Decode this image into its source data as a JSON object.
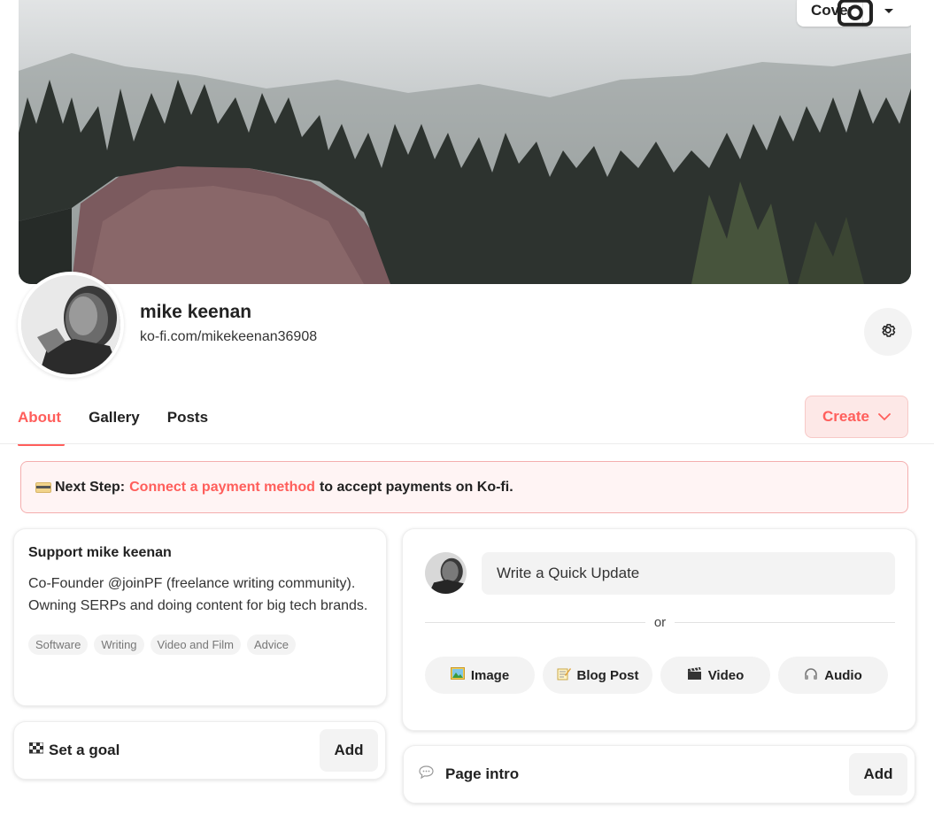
{
  "cover": {
    "button_label": "Cover",
    "camera_icon": "camera-icon",
    "dropdown_icon": "caret-down-icon"
  },
  "profile": {
    "name": "mike keenan",
    "handle": "ko-fi.com/mikekeenan36908",
    "settings_icon": "gear-icon"
  },
  "tabs": [
    {
      "label": "About",
      "active": true
    },
    {
      "label": "Gallery",
      "active": false
    },
    {
      "label": "Posts",
      "active": false
    }
  ],
  "create": {
    "label": "Create",
    "icon": "chevron-down-icon"
  },
  "banner": {
    "prefix": "Next Step:",
    "link": "Connect a payment method",
    "suffix": "to accept payments on Ko-fi."
  },
  "support": {
    "title": "Support mike keenan",
    "bio": "Co-Founder @joinPF (freelance writing community). Owning SERPs and doing content for big tech brands.",
    "tags": [
      "Software",
      "Writing",
      "Video and Film",
      "Advice"
    ]
  },
  "goal": {
    "label": "Set a goal",
    "add_label": "Add"
  },
  "update": {
    "placeholder": "Write a Quick Update",
    "or_text": "or",
    "media": [
      {
        "label": "Image",
        "icon": "image-icon"
      },
      {
        "label": "Blog Post",
        "icon": "memo-icon"
      },
      {
        "label": "Video",
        "icon": "clapper-icon"
      },
      {
        "label": "Audio",
        "icon": "headphones-icon"
      }
    ]
  },
  "intro": {
    "label": "Page intro",
    "add_label": "Add"
  },
  "colors": {
    "accent": "#ff5e5b",
    "banner_bg": "#fff4f4",
    "chip_bg": "#f3f3f3"
  }
}
